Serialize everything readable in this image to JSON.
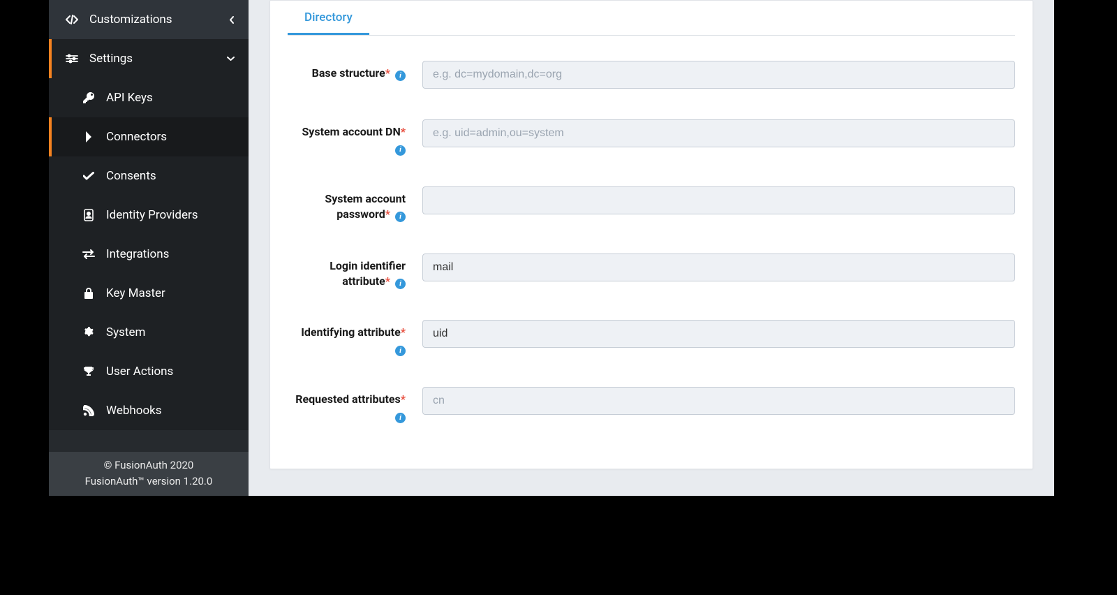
{
  "sidebar": {
    "customizations": {
      "label": "Customizations"
    },
    "settings": {
      "label": "Settings"
    },
    "sub": {
      "apiKeys": "API Keys",
      "connectors": "Connectors",
      "consents": "Consents",
      "identityProviders": "Identity Providers",
      "integrations": "Integrations",
      "keyMaster": "Key Master",
      "system": "System",
      "userActions": "User Actions",
      "webhooks": "Webhooks"
    }
  },
  "footer": {
    "copyright": "© FusionAuth 2020",
    "version": "FusionAuth™ version 1.20.0"
  },
  "tabs": {
    "directory": "Directory"
  },
  "form": {
    "baseStructure": {
      "label": "Base structure",
      "placeholder": "e.g. dc=mydomain,dc=org",
      "value": ""
    },
    "systemAccountDn": {
      "label": "System account DN",
      "placeholder": "e.g. uid=admin,ou=system",
      "value": ""
    },
    "systemAccountPassword": {
      "label": "System account password",
      "placeholder": "",
      "value": ""
    },
    "loginIdentifierAttribute": {
      "label": "Login identifier attribute",
      "placeholder": "",
      "value": "mail"
    },
    "identifyingAttribute": {
      "label": "Identifying attribute",
      "placeholder": "",
      "value": "uid"
    },
    "requestedAttributes": {
      "label": "Requested attributes",
      "placeholder": "cn",
      "value": ""
    }
  }
}
